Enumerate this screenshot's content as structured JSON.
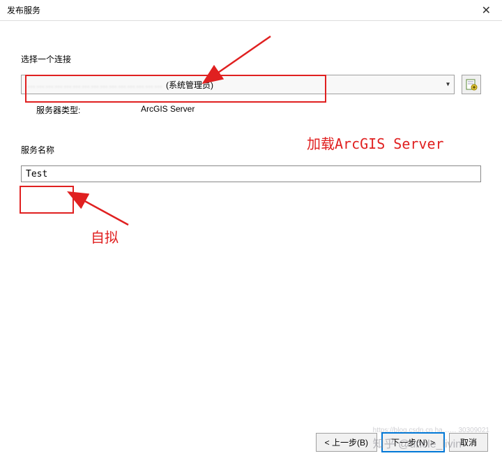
{
  "window": {
    "title": "发布服务"
  },
  "labels": {
    "choose_connection": "选择一个连接",
    "server_type_label": "服务器类型:",
    "server_type_value": "ArcGIS Server",
    "service_name": "服务名称"
  },
  "connection": {
    "display_suffix": "(系统管理员)",
    "obscured_prefix": "………………………………………"
  },
  "form": {
    "service_name_value": "Test"
  },
  "annotations": {
    "load_server": "加载ArcGIS Server",
    "custom_name": "自拟"
  },
  "buttons": {
    "back": "< 上一步(B)",
    "next": "下一步(N) >",
    "cancel": "取消"
  },
  "icons": {
    "close": "✕"
  },
  "watermark": {
    "main": "知乎 @uncle_livin",
    "sub": "https://blog.csdn.cn ha…… 30309021"
  },
  "colors": {
    "highlight": "#e02020"
  }
}
